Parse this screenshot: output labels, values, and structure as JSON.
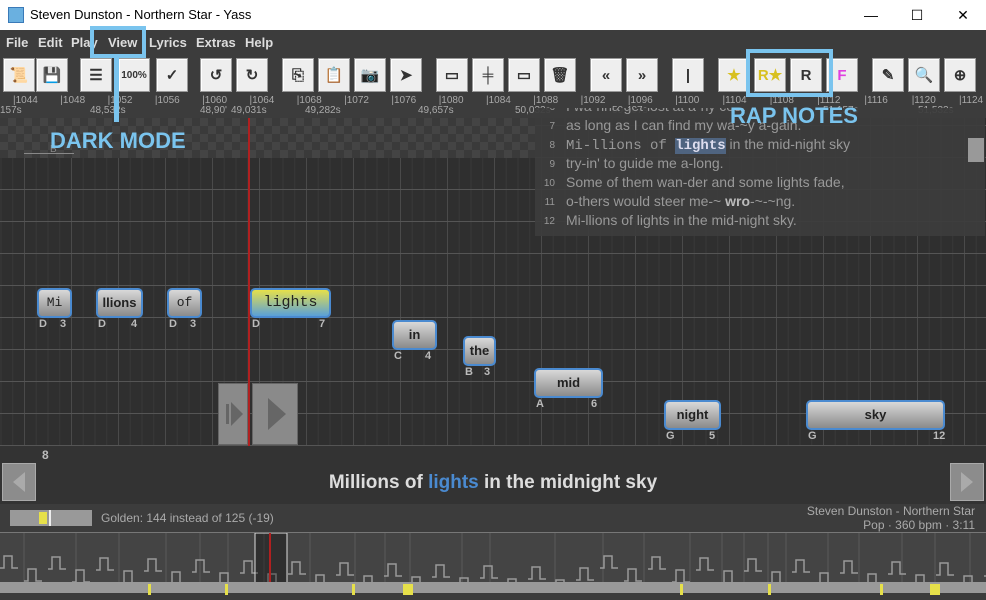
{
  "window": {
    "title": "Steven Dunston - Northern Star - Yass",
    "minimize": "—",
    "maximize": "☐",
    "close": "✕"
  },
  "menu": [
    "File",
    "Edit",
    "Play",
    "View",
    "Lyrics",
    "Extras",
    "Help"
  ],
  "toolbar": [
    {
      "icon": "lyrics-scroll-icon",
      "g": "📜"
    },
    {
      "icon": "save-icon",
      "g": "💾"
    },
    {
      "icon": "view-mode-icon",
      "g": "☰"
    },
    {
      "icon": "zoom-100-icon",
      "g": "100%"
    },
    {
      "icon": "check-icon",
      "g": "✓"
    },
    {
      "icon": "undo-icon",
      "g": "↺"
    },
    {
      "icon": "redo-icon",
      "g": "↻"
    },
    {
      "icon": "copy-icon",
      "g": "⎘"
    },
    {
      "icon": "paste-icon",
      "g": "📋"
    },
    {
      "icon": "snapshot-icon",
      "g": "📷"
    },
    {
      "icon": "select-icon",
      "g": "➤"
    },
    {
      "icon": "split-note-icon",
      "g": "▭"
    },
    {
      "icon": "join-note-icon",
      "g": "╪"
    },
    {
      "icon": "add-note-icon",
      "g": "▭"
    },
    {
      "icon": "delete-icon",
      "g": "🗑"
    },
    {
      "icon": "shift-left-icon",
      "g": "«"
    },
    {
      "icon": "shift-right-icon",
      "g": "»"
    },
    {
      "icon": "page-break-icon",
      "g": "|"
    },
    {
      "icon": "golden-icon",
      "g": "★"
    },
    {
      "icon": "rap-golden-icon",
      "g": "R★"
    },
    {
      "icon": "rap-icon",
      "g": "R"
    },
    {
      "icon": "freestyle-icon",
      "g": "F"
    },
    {
      "icon": "edit-lyrics-icon",
      "g": "✎"
    },
    {
      "icon": "zoom-one-icon",
      "g": "🔍"
    },
    {
      "icon": "zoom-in-icon",
      "g": "⊕"
    }
  ],
  "ruler": {
    "beats": [
      "|1044",
      "|1048",
      "|1052",
      "|1056",
      "|1060",
      "|1064",
      "|1068",
      "|1072",
      "|1076",
      "|1080",
      "|1084",
      "|1088",
      "|1092",
      "|1096",
      "|1100",
      "|1104",
      "|1108",
      "|1112",
      "|1116",
      "|1120",
      "|1124"
    ],
    "times": [
      "157s",
      "48,532s",
      "48,90'",
      "49,031s",
      "49,282s",
      "49,657s",
      "50,032s",
      "50,407s",
      "51,157s",
      "51,532s"
    ]
  },
  "notes": [
    {
      "text": "Mi",
      "pitch": "D",
      "len": "3",
      "mono": true
    },
    {
      "text": "llions",
      "pitch": "D",
      "len": "4"
    },
    {
      "text": "of",
      "pitch": "D",
      "len": "3",
      "mono": true
    },
    {
      "text": "lights",
      "pitch": "D",
      "len": "7",
      "mono": true,
      "current": true
    },
    {
      "text": "in",
      "pitch": "C",
      "len": "4"
    },
    {
      "text": "the",
      "pitch": "B",
      "len": "3"
    },
    {
      "text": "mid",
      "pitch": "A",
      "len": "6"
    },
    {
      "text": "night",
      "pitch": "G",
      "len": "5"
    },
    {
      "text": "sky",
      "pitch": "G",
      "len": "12"
    }
  ],
  "marker": "B",
  "lyrics": [
    {
      "n": "6",
      "t": "I wa-nna get lost at a-ny cost"
    },
    {
      "n": "7",
      "t": "as long as I can find my wa-~y a-gain."
    },
    {
      "n": "8",
      "pre": "Mi-llions of ",
      "hl": "lights",
      "post": " in the mid-night sky"
    },
    {
      "n": "9",
      "t": "try-in' to guide me a-long."
    },
    {
      "n": "10",
      "t": "Some of them wan-der and some lights fade,"
    },
    {
      "n": "11",
      "pre2": "o-thers would steer me-~ ",
      "b": "wro",
      "post2": "-~-~ng."
    },
    {
      "n": "12",
      "t": "Mi-llions of lights in the mid-night sky."
    }
  ],
  "page_number": "8",
  "current_line": {
    "before": "Millions of ",
    "hl": "lights",
    "after": " in the midnight sky"
  },
  "status": {
    "golden": "Golden: 144 instead of 125 (-19)",
    "song": "Steven Dunston - Northern Star",
    "info": "Pop · 360 bpm · 3:11"
  },
  "annotations": {
    "view": "DARK MODE",
    "rap": "RAP NOTES"
  },
  "colors": {
    "accent": "#7ac4ee",
    "cursor": "#b02020",
    "highlight": "#4a8ad0",
    "golden": "#e6e04a"
  }
}
